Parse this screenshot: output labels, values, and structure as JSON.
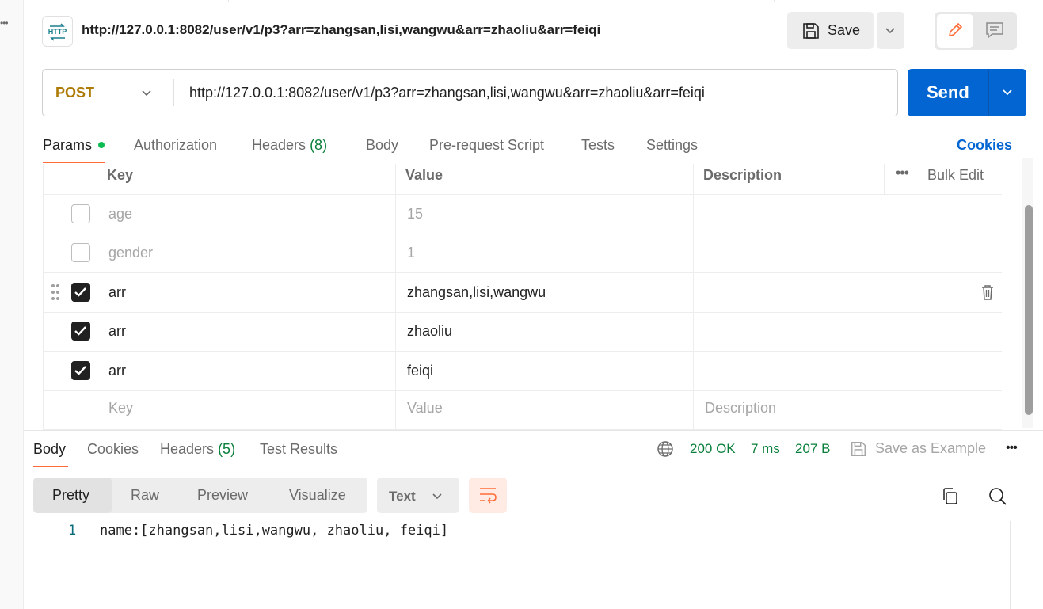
{
  "request": {
    "title": "http://127.0.0.1:8082/user/v1/p3?arr=zhangsan,lisi,wangwu&arr=zhaoliu&arr=feiqi",
    "method": "POST",
    "url": "http://127.0.0.1:8082/user/v1/p3?arr=zhangsan,lisi,wangwu&arr=zhaoliu&arr=feiqi",
    "icon_text": "HTTP"
  },
  "toolbar": {
    "save_label": "Save",
    "send_label": "Send"
  },
  "request_tabs": {
    "params": "Params",
    "authorization": "Authorization",
    "headers": "Headers",
    "headers_count": "(8)",
    "body": "Body",
    "pre_request": "Pre-request Script",
    "tests": "Tests",
    "settings": "Settings",
    "cookies": "Cookies"
  },
  "params_table": {
    "headers": {
      "key": "Key",
      "value": "Value",
      "description": "Description",
      "bulk_edit": "Bulk Edit"
    },
    "rows": [
      {
        "key": "age",
        "value": "15",
        "description": "",
        "checked": false
      },
      {
        "key": "gender",
        "value": "1",
        "description": "",
        "checked": false
      },
      {
        "key": "arr",
        "value": "zhangsan,lisi,wangwu",
        "description": "",
        "checked": true
      },
      {
        "key": "arr",
        "value": "zhaoliu",
        "description": "",
        "checked": true
      },
      {
        "key": "arr",
        "value": "feiqi",
        "description": "",
        "checked": true
      }
    ],
    "placeholders": {
      "key": "Key",
      "value": "Value",
      "description": "Description"
    }
  },
  "response_tabs": {
    "body": "Body",
    "cookies": "Cookies",
    "headers": "Headers",
    "headers_count": "(5)",
    "test_results": "Test Results"
  },
  "response_status": {
    "status": "200 OK",
    "time": "7 ms",
    "size": "207 B",
    "save_example": "Save as Example"
  },
  "view_modes": {
    "pretty": "Pretty",
    "raw": "Raw",
    "preview": "Preview",
    "visualize": "Visualize",
    "format": "Text"
  },
  "response_body": {
    "line_number": "1",
    "content": "name:[zhangsan,lisi,wangwu, zhaoliu, feiqi]"
  },
  "colors": {
    "accent": "#ff6c37",
    "send": "#0265d2",
    "method": "#ad7a03",
    "success": "#0a7f3b"
  }
}
